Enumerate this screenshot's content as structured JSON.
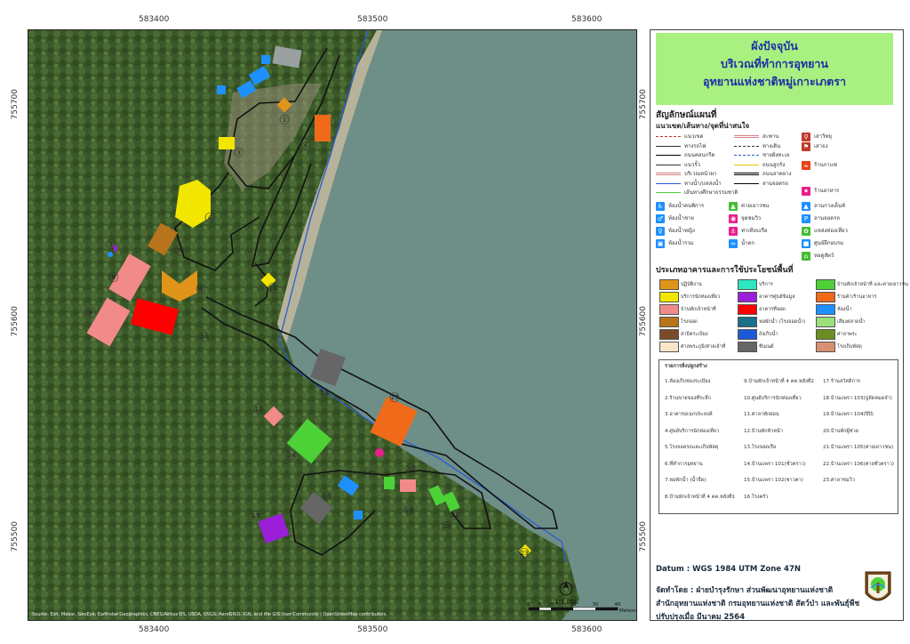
{
  "coords": {
    "top": [
      "583400",
      "583500",
      "583600"
    ],
    "bottom": [
      "583400",
      "583500",
      "583600"
    ],
    "left": [
      "755700",
      "755600",
      "755500"
    ],
    "right": [
      "755700",
      "755600",
      "755500"
    ]
  },
  "map": {
    "attribution": "Source: Esri, Maxar, GeoEye, Earthstar Geographics, CNES/Airbus DS, USDA, USGS, AeroGRID, IGN, and the GIS User Community | OpenStreetMap contributors",
    "scale_ratio": "1:1,000",
    "scale_ticks": [
      "0",
      "5",
      "10",
      "20",
      "30",
      "40"
    ],
    "scale_unit": "Meters",
    "building_labels": [
      "1",
      "2",
      "3",
      "4",
      "5",
      "6",
      "7",
      "8",
      "9",
      "10",
      "11",
      "12",
      "13",
      "14",
      "15",
      "16",
      "17",
      "18",
      "19",
      "20",
      "21",
      "22",
      "23"
    ],
    "colors": {
      "sea": "#6c8f86",
      "forest": "#3f5b2d",
      "beach": "#cfc7b0",
      "road": "#111111",
      "stream": "#2a5bd7"
    }
  },
  "title": {
    "line1": "ผังปัจจุบัน",
    "line2": "บริเวณที่ทำการอุทยาน",
    "line3": "อุทยานแห่งชาติหมู่เกาะเภตรา"
  },
  "legend": {
    "heading": "สัญลักษณ์แผนที่",
    "subheading": "แนวเขต/เส้นทาง/จุดที่น่าสนใจ",
    "lines": [
      {
        "label": "แนวเขต",
        "color": "#c0392b",
        "style": "dashed"
      },
      {
        "label": "สะพาน",
        "color": "#e08080",
        "style": "double"
      },
      {
        "label": "ทางรถไฟ",
        "color": "#333",
        "style": "rail"
      },
      {
        "label": "ทางเดิน",
        "color": "#333",
        "style": "dashdot"
      },
      {
        "label": "ถนนคอนกรีต",
        "color": "#000",
        "style": "solid"
      },
      {
        "label": "ชายฝั่งทะเล",
        "color": "#2a5bd7",
        "style": "dashed"
      },
      {
        "label": "แนวรั้ว",
        "color": "#333",
        "style": "arrows"
      },
      {
        "label": "ถนนลูกรัง",
        "color": "#e6c200",
        "style": "solid"
      },
      {
        "label": "บริเวณหน้าผา",
        "color": "#d08080",
        "style": "double"
      },
      {
        "label": "ถนนลาดยาง",
        "color": "#000",
        "style": "double"
      },
      {
        "label": "ทางน้ำ/แหล่งน้ำ",
        "color": "#2a5bd7",
        "style": "solid"
      },
      {
        "label": "ลานจอดรถ",
        "color": "#000",
        "style": "box"
      },
      {
        "label": "เส้นทางศึกษาธรรมชาติ",
        "color": "#4cd137",
        "style": "solid"
      }
    ],
    "points": [
      {
        "label": "เสาวิทยุ",
        "icon": "antenna-icon",
        "color": "#c0392b"
      },
      {
        "label": "เสาธง",
        "icon": "flag-icon",
        "color": "#c0392b"
      },
      {
        "label": "ร้านกาแฟ",
        "icon": "coffee-icon",
        "color": "#e84118"
      },
      {
        "label": "ห้องน้ำคนพิการ",
        "icon": "accessible-toilet-icon",
        "color": "#1e90ff"
      },
      {
        "label": "ค่ายเยาวชน",
        "icon": "camp-icon",
        "color": "#44bd32"
      },
      {
        "label": "ร้านอาหาร",
        "icon": "restaurant-icon",
        "color": "#e91e8c"
      },
      {
        "label": "ห้องน้ำชาย",
        "icon": "male-toilet-icon",
        "color": "#1e90ff"
      },
      {
        "label": "จุดชมวิว",
        "icon": "viewpoint-icon",
        "color": "#e91e8c"
      },
      {
        "label": "ลานกางเต็นท์",
        "icon": "tent-icon",
        "color": "#1e90ff"
      },
      {
        "label": "ห้องน้ำหญิง",
        "icon": "female-toilet-icon",
        "color": "#1e90ff"
      },
      {
        "label": "ท่าเทียบเรือ",
        "icon": "pier-icon",
        "color": "#e91e8c"
      },
      {
        "label": "ลานจอดรถ",
        "icon": "parking-icon",
        "color": "#1e90ff"
      },
      {
        "label": "ห้องน้ำรวม",
        "icon": "toilet-icon",
        "color": "#1e90ff"
      },
      {
        "label": "น้ำตก",
        "icon": "waterfall-icon",
        "color": "#1e90ff"
      },
      {
        "label": "แหล่งท่องเที่ยว",
        "icon": "attraction-icon",
        "color": "#44bd32"
      },
      {
        "label": "ศูนย์ฝึกอบรม",
        "icon": "training-icon",
        "color": "#1e90ff"
      },
      {
        "label": "หอดูสัตว์",
        "icon": "watchtower-icon",
        "color": "#44bd32"
      }
    ],
    "landuse_heading": "ประเภทอาคารและการใช้ประโยชน์พื้นที่",
    "landuse": [
      {
        "label": "ปฏิบัติงาน",
        "color": "#e1941a"
      },
      {
        "label": "บริการ",
        "color": "#2ee6c0"
      },
      {
        "label": "บ้านพักเจ้าหน้าที่ และค่ายเยาวชน",
        "color": "#4cd137"
      },
      {
        "label": "บริการนักท่องเที่ยว",
        "color": "#f2e600"
      },
      {
        "label": "อาคารศูนย์ข้อมูล",
        "color": "#9b1ed8"
      },
      {
        "label": "ร้านค้า/ร้านอาหาร",
        "color": "#f06a1a"
      },
      {
        "label": "บ้านพักเจ้าหน้าที่",
        "color": "#f28a8a"
      },
      {
        "label": "อาคารที่จอด",
        "color": "#ff0000"
      },
      {
        "label": "ห้องน้ำ",
        "color": "#1e90ff"
      },
      {
        "label": "โรงจอด",
        "color": "#b8741a"
      },
      {
        "label": "หอพักน้ำ (โรงจอดน้ำ)",
        "color": "#1a6f8a"
      },
      {
        "label": "เสียงตลาดน้ำ",
        "color": "#9be07a"
      },
      {
        "label": "สาธิตระเบียง",
        "color": "#7a4a2a"
      },
      {
        "label": "ถังเก็บน้ำ",
        "color": "#1a5ad8"
      },
      {
        "label": "ศาลาพระ",
        "color": "#6b8e23"
      },
      {
        "label": "ศาลพระภูมิ/ศาลเจ้าที่",
        "color": "#f7e7c6"
      },
      {
        "label": "ซีเมนต์",
        "color": "#666666"
      },
      {
        "label": "โรงเก็บพัสดุ",
        "color": "#d99070"
      }
    ]
  },
  "building_list": {
    "heading": "รายการสิ่งปลูกสร้าง",
    "col1": [
      "1.ห้องเก็บช่องระเบียง",
      "2.ร้านขายของที่ระลึก",
      "3.อาคารอเนกประสงค์",
      "4.ศูนย์บริการนักท่องเที่ยว",
      "5.โรงจอดรถและเก็บพัสดุ",
      "6.ที่ทำการอุทยาน",
      "7.หอพักน้ำ (น้ำจืด)",
      "8.บ้านพักเจ้าหน้าที่ 4 คค.หลังที่1"
    ],
    "col2": [
      "9.บ้านพักเจ้าหน้าที่ 4 คค.หลังที่2",
      "10.ศูนย์บริการนักท่องเที่ยว",
      "11.ศาลาพักผ่อน",
      "12.บ้านพักหัวหน้า",
      "13.โรงจอดเรือ",
      "14.บ้านเเพรา 101(ชั่วคราว)",
      "15.บ้านเเพรา 102(ชาวคา)",
      "16.โรงครัว"
    ],
    "col3": [
      "17.ร้านสวัสดิการ",
      "18.บ้านเเพรา 103(ปูลัดหมดจำ)",
      "19.บ้านเเพรา 104(ปิปิ)",
      "20.บ้านพักผู้ช่วย",
      "21.บ้านเเพรา 105(ค่ายเยาวชน)",
      "22.บ้านเเพรา 106(ค่ายชั่วคราว)",
      "23.ศาลาชมวิว"
    ]
  },
  "footer": {
    "datum": "Datum  : WGS 1984 UTM Zone 47N",
    "made_by": "จัดทำโดย  : ฝ่ายบำรุงรักษา ส่วนพัฒนาอุทยานแห่งชาติ",
    "office": "สำนักอุทยานแห่งชาติ  กรมอุทยานแห่งชาติ สัตว์ป่า และพันธุ์พืช",
    "updated": "ปรับปรุงเมื่อ มีนาคม 2564"
  }
}
